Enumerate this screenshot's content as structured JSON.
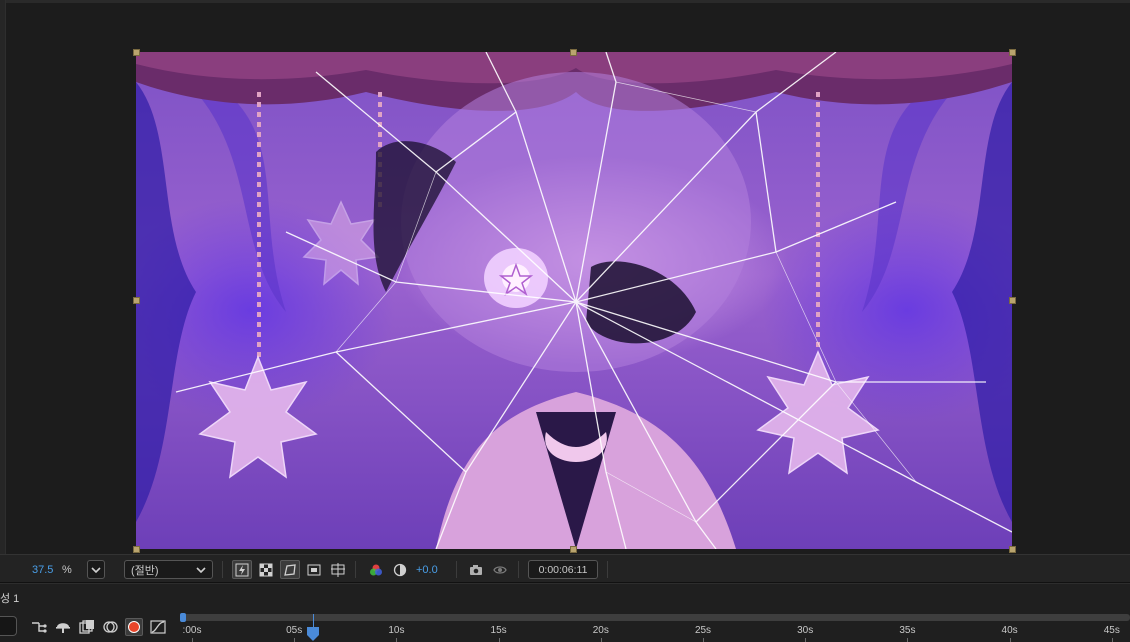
{
  "viewer": {
    "zoom_value": "37.5",
    "zoom_unit": "%",
    "resolution": "(절반)",
    "exposure": "+0.0",
    "timecode": "0:00:06:11",
    "colors": {
      "accent": "#4a9fe8",
      "handle": "#b9a46e",
      "background": "#1c1c1c"
    }
  },
  "timeline": {
    "comp_tab": "성 1",
    "ruler_labels": [
      ":00s",
      "05s",
      "10s",
      "15s",
      "20s",
      "25s",
      "30s",
      "35s",
      "40s",
      "45s"
    ],
    "playhead_label": "0:00:06:11"
  },
  "icons": {
    "toolbar": [
      "fast-preview-icon",
      "transparency-grid-icon",
      "mask-path-icon",
      "region-of-interest-icon",
      "guides-icon",
      "color-channel-icon",
      "reset-exposure-icon",
      "snapshot-icon",
      "show-snapshot-icon"
    ],
    "timeline": [
      "composition-flowchart-icon",
      "shy-layers-icon",
      "frame-blending-icon",
      "motion-blur-icon",
      "record-icon",
      "graph-editor-icon"
    ]
  }
}
